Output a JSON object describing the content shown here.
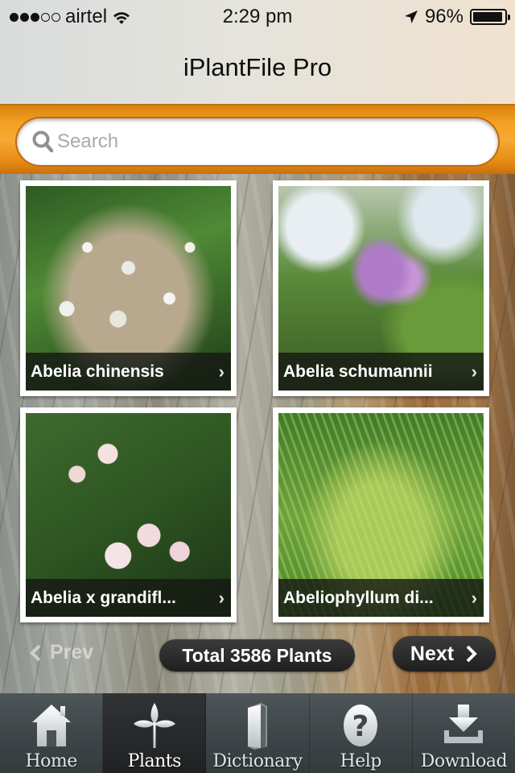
{
  "status_bar": {
    "signal_strength": "3 of 5",
    "carrier": "airtel",
    "time": "2:29 pm",
    "battery_percent": "96%",
    "battery_level": 0.96,
    "icons": [
      "signal-dots-icon",
      "wifi-icon",
      "location-arrow-icon",
      "battery-icon"
    ]
  },
  "header": {
    "title": "iPlantFile Pro"
  },
  "search": {
    "placeholder": "Search",
    "value": "",
    "icon": "search-icon"
  },
  "plants": [
    {
      "name": "Abelia chinensis",
      "chevron": "›"
    },
    {
      "name": "Abelia schumannii",
      "chevron": "›"
    },
    {
      "name": "Abelia x grandifl...",
      "chevron": "›"
    },
    {
      "name": "Abeliophyllum di...",
      "chevron": "›"
    }
  ],
  "pager": {
    "prev_label": "Prev",
    "prev_enabled": false,
    "total_label": "Total 3586 Plants",
    "next_label": "Next"
  },
  "tabbar": {
    "active": "Plants",
    "tabs": [
      {
        "label": "Home",
        "icon": "home-icon"
      },
      {
        "label": "Plants",
        "icon": "plant-sprout-icon"
      },
      {
        "label": "Dictionary",
        "icon": "book-icon"
      },
      {
        "label": "Help",
        "icon": "help-question-icon"
      },
      {
        "label": "Download",
        "icon": "download-icon"
      }
    ]
  },
  "colors": {
    "search_band": "#f2a122",
    "tabbar": "#3f4649",
    "active_tab": "#1f2123",
    "caption_bg": "#161a14"
  }
}
